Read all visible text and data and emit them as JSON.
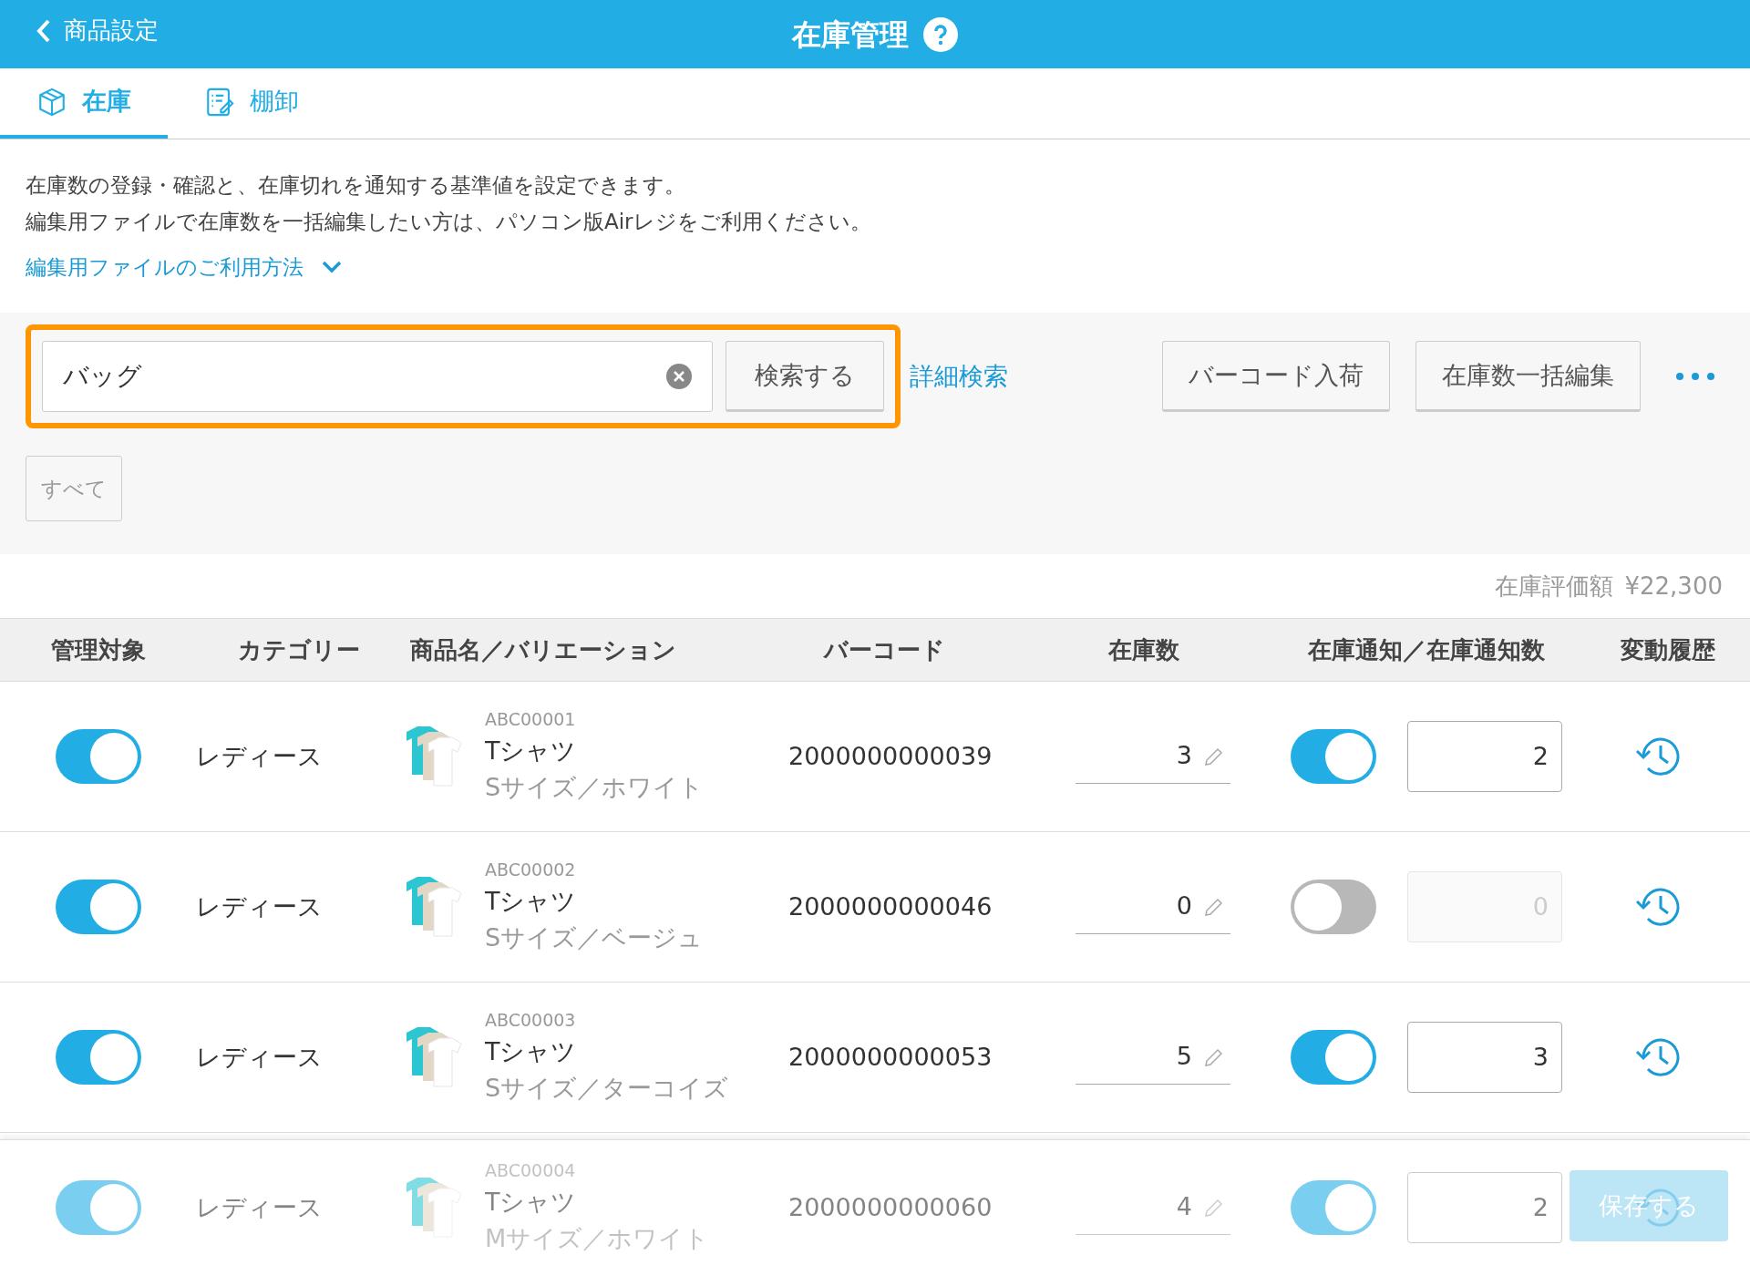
{
  "header": {
    "back_label": "商品設定",
    "title": "在庫管理"
  },
  "tabs": [
    {
      "label": "在庫",
      "kind": "box",
      "selected": true
    },
    {
      "label": "棚卸",
      "kind": "checklist",
      "selected": false
    }
  ],
  "description": [
    "在庫数の登録・確認と、在庫切れを通知する基準値を設定できます。",
    "編集用ファイルで在庫数を一括編集したい方は、パソコン版Airレジをご利用ください。"
  ],
  "help_link": {
    "label": "編集用ファイルのご利用方法",
    "expanded": false
  },
  "search": {
    "value": "バッグ",
    "search_button": "検索する",
    "advanced_link": "詳細検索"
  },
  "actions": [
    "バーコード入荷",
    "在庫数一括編集"
  ],
  "filter_chips": [
    {
      "label": "すべて"
    }
  ],
  "total": {
    "label": "在庫評価額",
    "value": "¥22,300"
  },
  "table": {
    "columns": [
      "管理対象",
      "カテゴリー",
      "商品名／バリエーション",
      "バーコード",
      "在庫数",
      "在庫通知／在庫通知数",
      "変動履歴"
    ],
    "rows": [
      {
        "managed": true,
        "category": "レディース",
        "code": "ABC00001",
        "name": "Tシャツ",
        "variation": "Sサイズ／ホワイト",
        "barcode": "2000000000039",
        "stock": "3",
        "notify": true,
        "notify_count": "2"
      },
      {
        "managed": true,
        "category": "レディース",
        "code": "ABC00002",
        "name": "Tシャツ",
        "variation": "Sサイズ／ベージュ",
        "barcode": "2000000000046",
        "stock": "0",
        "notify": false,
        "notify_count": "0"
      },
      {
        "managed": true,
        "category": "レディース",
        "code": "ABC00003",
        "name": "Tシャツ",
        "variation": "Sサイズ／ターコイズ",
        "barcode": "2000000000053",
        "stock": "5",
        "notify": true,
        "notify_count": "3"
      },
      {
        "managed": true,
        "category": "レディース",
        "code": "ABC00004",
        "name": "Tシャツ",
        "variation": "Mサイズ／ホワイト",
        "barcode": "2000000000060",
        "stock": "4",
        "notify": true,
        "notify_count": "2"
      }
    ]
  },
  "save_button": "保存する"
}
